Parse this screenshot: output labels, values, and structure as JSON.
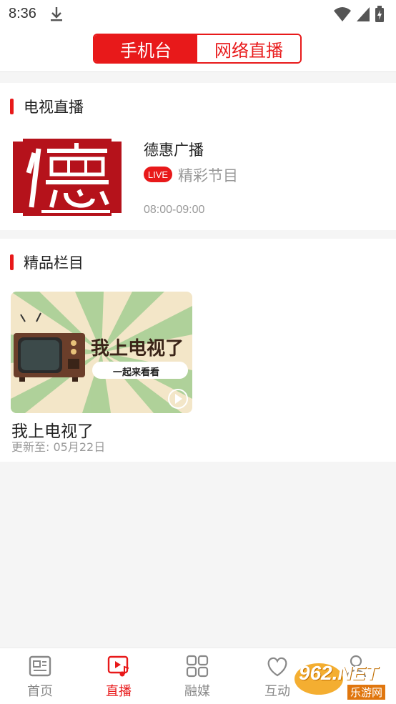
{
  "status_bar": {
    "time": "8:36"
  },
  "top_tabs": [
    {
      "label": "手机台",
      "active": true
    },
    {
      "label": "网络直播",
      "active": false
    }
  ],
  "tv_section": {
    "title": "电视直播",
    "channel": {
      "logo_char": "德",
      "name": "德惠广播",
      "live_badge": "LIVE",
      "program": "精彩节目",
      "time": "08:00-09:00"
    }
  },
  "featured_section": {
    "title": "精品栏目",
    "items": [
      {
        "thumb_title": "我上电视了",
        "thumb_subtitle": "一起来看看",
        "title": "我上电视了",
        "update": "更新至: 05月22日"
      }
    ]
  },
  "bottom_nav": [
    {
      "label": "首页",
      "icon": "news-icon",
      "active": false
    },
    {
      "label": "直播",
      "icon": "live-tv-icon",
      "active": true
    },
    {
      "label": "融媒",
      "icon": "grid-icon",
      "active": false
    },
    {
      "label": "互动",
      "icon": "heart-icon",
      "active": false
    },
    {
      "label": "",
      "icon": "user-icon",
      "active": false
    }
  ],
  "watermark": {
    "text": "962.NET",
    "sub": "乐游网"
  },
  "colors": {
    "accent": "#e8191a",
    "text": "#222222",
    "muted": "#999999"
  }
}
